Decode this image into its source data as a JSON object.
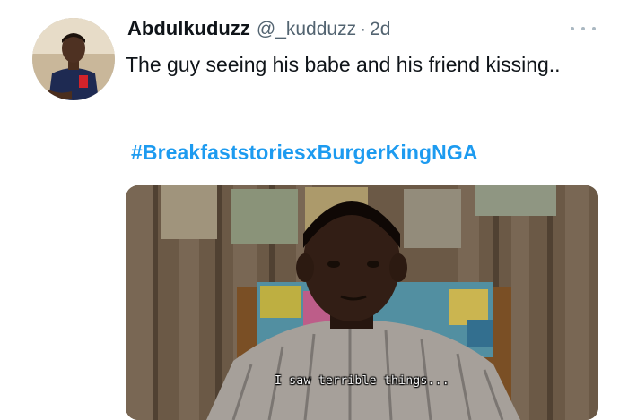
{
  "tweet": {
    "display_name": "Abdulkuduzz",
    "handle": "@_kudduzz",
    "separator": "·",
    "time": "2d",
    "text": "The guy seeing his babe and his friend kissing..",
    "hashtag": "#BreakfaststoriesxBurgerKingNGA",
    "more_icon": "more-horizontal-icon",
    "media": {
      "subtitle": "I saw terrible things..."
    }
  },
  "colors": {
    "link": "#1d9bf0",
    "secondary_text": "#536471",
    "primary_text": "#0f1419"
  }
}
